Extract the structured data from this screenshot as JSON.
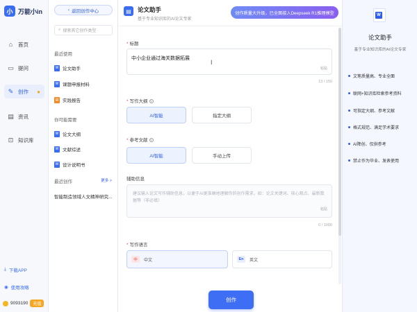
{
  "brand": {
    "logo_mark": "小",
    "name": "万能小in"
  },
  "nav": {
    "items": [
      {
        "label": "首页",
        "icon": "home-icon",
        "glyph": "⌂"
      },
      {
        "label": "提问",
        "icon": "chat-icon",
        "glyph": "▭"
      },
      {
        "label": "创作",
        "icon": "pen-icon",
        "glyph": "✎"
      },
      {
        "label": "资讯",
        "icon": "news-icon",
        "glyph": "▤"
      },
      {
        "label": "知识库",
        "icon": "knowledge-icon",
        "glyph": "⊡"
      }
    ],
    "download_app": "下载APP",
    "guide": "使用攻略",
    "points": "9093190",
    "recharge": "充值"
  },
  "side": {
    "back_label": "返回创作中心",
    "search_placeholder": "搜索其它创作类型",
    "recent_heading": "最近使用",
    "recent": [
      "论文助手",
      "课题申报材料",
      "实践报告"
    ],
    "maybe_heading": "你可能需要",
    "maybe": [
      "论文大纲",
      "文献综述",
      "设计说明书"
    ],
    "recent_creation_heading": "最近创作",
    "more": "更多 >",
    "recent_creation_item": "智能制造领域人文精神研究..."
  },
  "main": {
    "title": "论文助手",
    "subtitle": "基于专业知识库的AI论文专家",
    "banner": "创作质量大升级，已全面接入Deepseek R1推理模型",
    "title_label": "标题",
    "title_value": "中小企业通过海关数据拓展",
    "paste": "粘贴",
    "title_counter": "13 / 150",
    "outline_label": "写作大纲",
    "outline_options": [
      "AI智能",
      "指定大纲"
    ],
    "ref_label": "参考文献",
    "ref_options": [
      "AI智能",
      "手动上传"
    ],
    "aux_label": "辅助信息",
    "aux_placeholder": "建议输入论文写作辅助信息，以便于AI更准确地理解你的创作需求，如：论文关键词、核心观点、最新数据等（非必填）",
    "aux_counter": "0 / 1000",
    "lang_label": "写作语言",
    "languages": [
      {
        "flag": "中",
        "label": "中文"
      },
      {
        "flag": "En",
        "label": "英文"
      }
    ],
    "create_button": "创作"
  },
  "info": {
    "word_icon": "W",
    "title": "论文助手",
    "subtitle": "基于专业知识库的AI论文专家",
    "features": [
      "文笔质量高、专业全面",
      "联网+知识库检索参考资料",
      "可指定大纲、参考文献",
      "格式规范、满足学术要求",
      "AI降创、仅供参考",
      "禁止作为毕业、发表使用"
    ]
  },
  "colors": {
    "accent": "#2f5fe8",
    "button": "#3d6ef3",
    "warning": "#f5a623"
  }
}
